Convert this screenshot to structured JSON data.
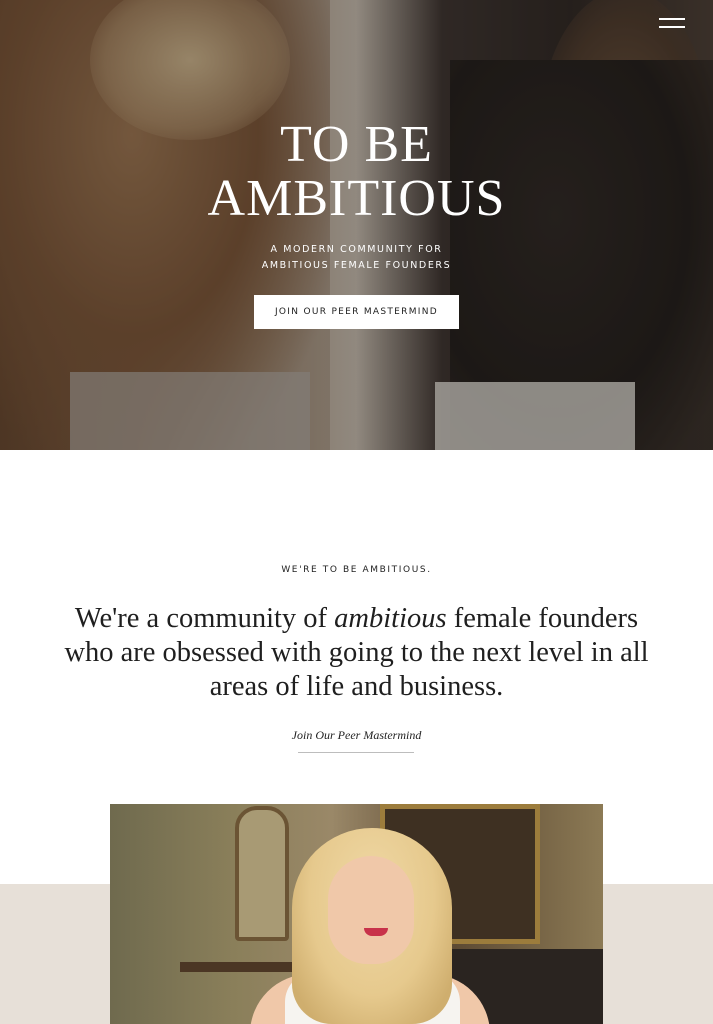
{
  "hero": {
    "title_line1": "TO BE",
    "title_line2": "AMBITIOUS",
    "subtitle_line1": "A MODERN COMMUNITY FOR",
    "subtitle_line2": "AMBITIOUS FEMALE FOUNDERS",
    "cta_label": "JOIN OUR PEER MASTERMIND",
    "menu_icon": "hamburger-menu-icon"
  },
  "intro": {
    "eyebrow": "WE'RE TO BE AMBITIOUS.",
    "statement_before": "We're a community of ",
    "statement_emphasis": "ambitious",
    "statement_after": " female founders who are obsessed with going to the next level in all areas of life and business.",
    "link_label": "Join Our Peer Mastermind"
  },
  "colors": {
    "background": "#ffffff",
    "band": "#e7e0d8",
    "text": "#1f1f1f",
    "button_bg": "#ffffff"
  }
}
